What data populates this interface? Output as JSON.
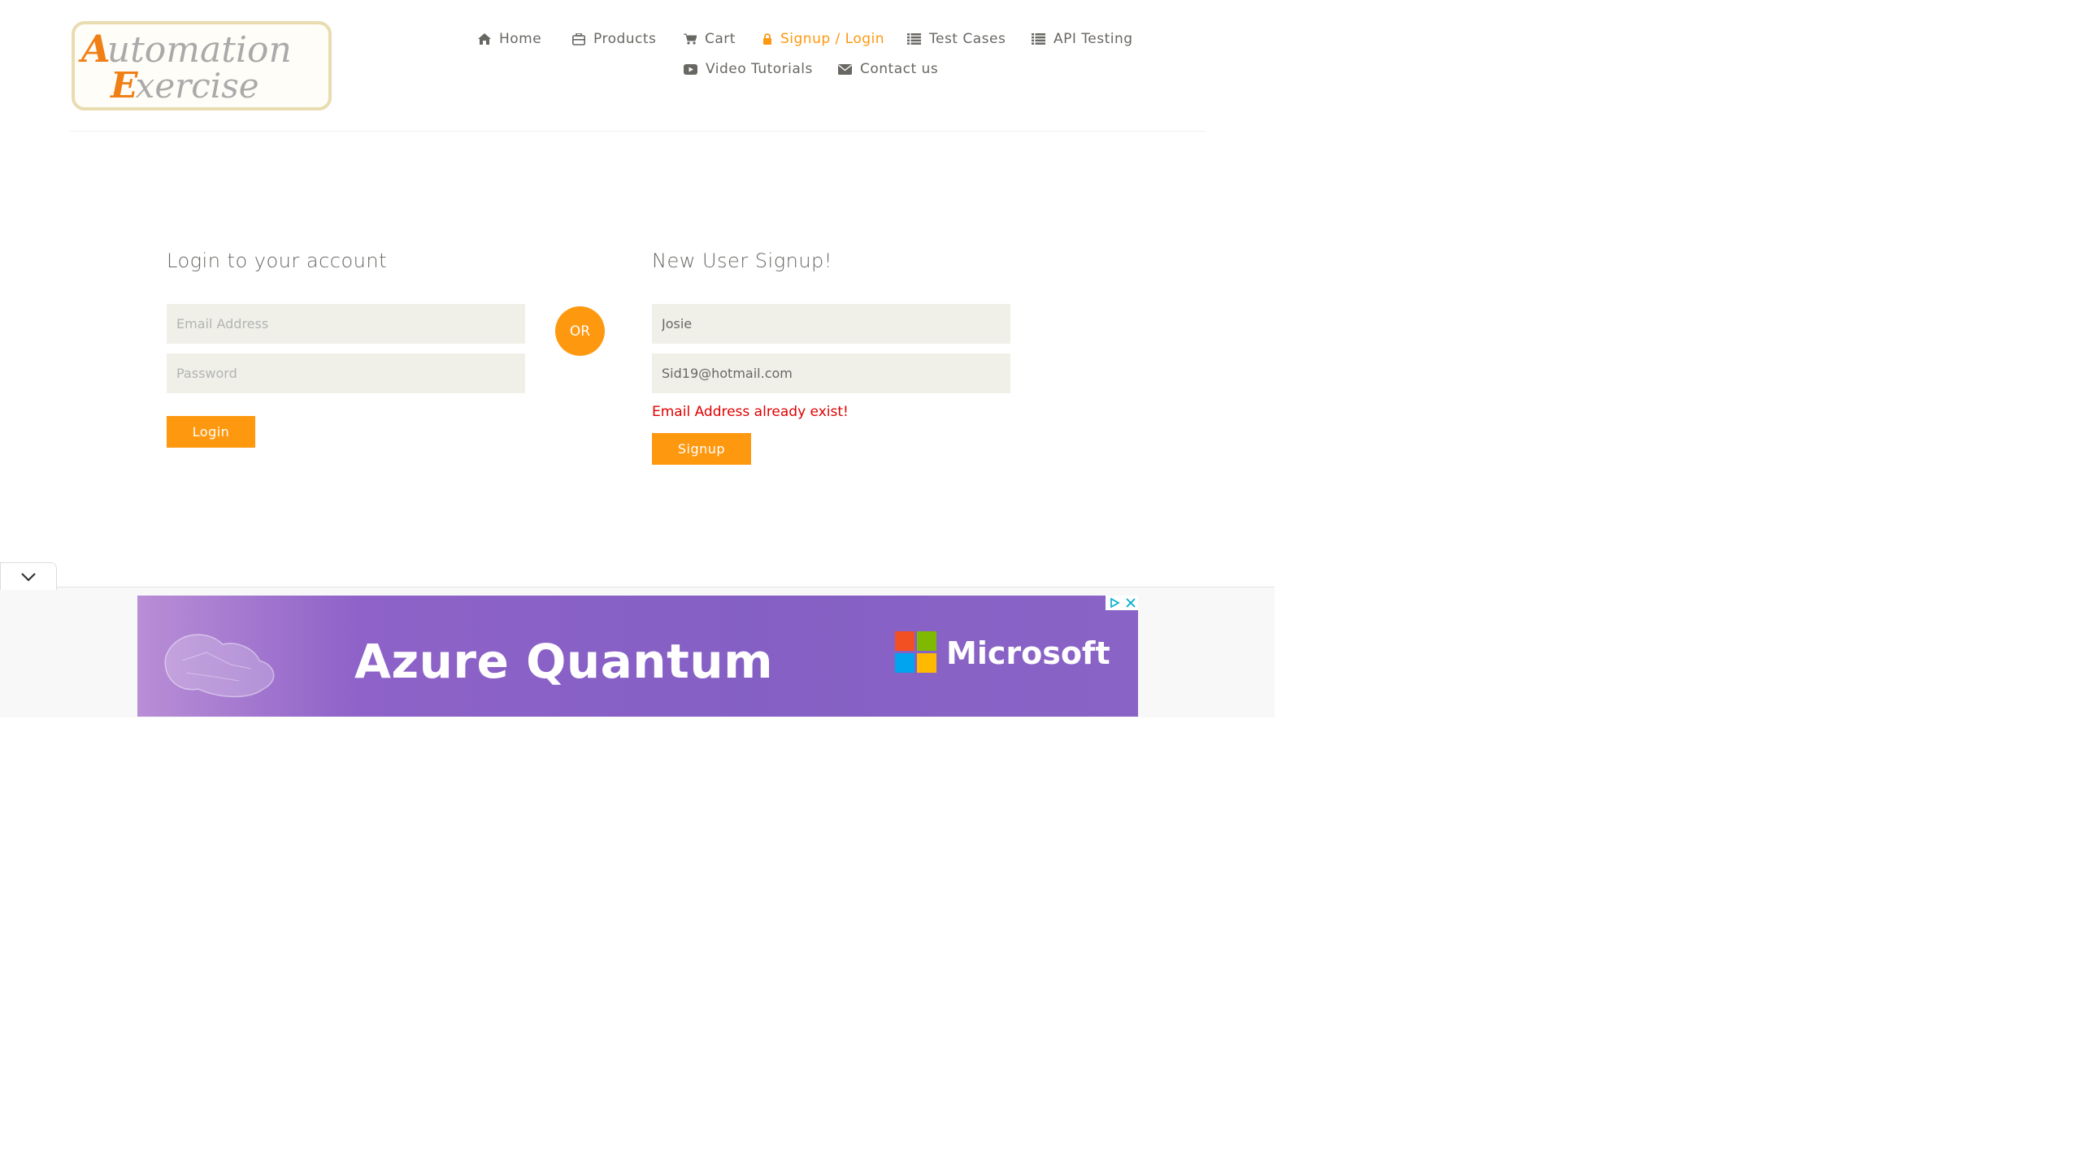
{
  "logo": {
    "line1": "Automation",
    "line2": "Exercise"
  },
  "nav": {
    "home": "Home",
    "products": "Products",
    "cart": "Cart",
    "signup_login": "Signup / Login",
    "test_cases": "Test Cases",
    "api_testing": "API Testing",
    "video_tutorials": "Video Tutorials",
    "contact_us": "Contact us"
  },
  "login": {
    "title": "Login to your account",
    "email_placeholder": "Email Address",
    "password_placeholder": "Password",
    "button": "Login"
  },
  "or_label": "OR",
  "signup": {
    "title": "New User Signup!",
    "name_value": "Josie",
    "email_value": "Sid19@hotmail.com",
    "error": "Email Address already exist!",
    "button": "Signup"
  },
  "ad": {
    "headline": "Azure Quantum",
    "brand": "Microsoft"
  },
  "colors": {
    "accent": "#fe980f",
    "error": "#e00000",
    "text": "#696763",
    "input_bg": "#f0f0e9"
  },
  "icons": [
    "home-icon",
    "products-icon",
    "cart-icon",
    "lock-icon",
    "list-icon",
    "video-icon",
    "envelope-icon",
    "chevron-down-icon",
    "ad-choices-icon",
    "close-icon"
  ]
}
